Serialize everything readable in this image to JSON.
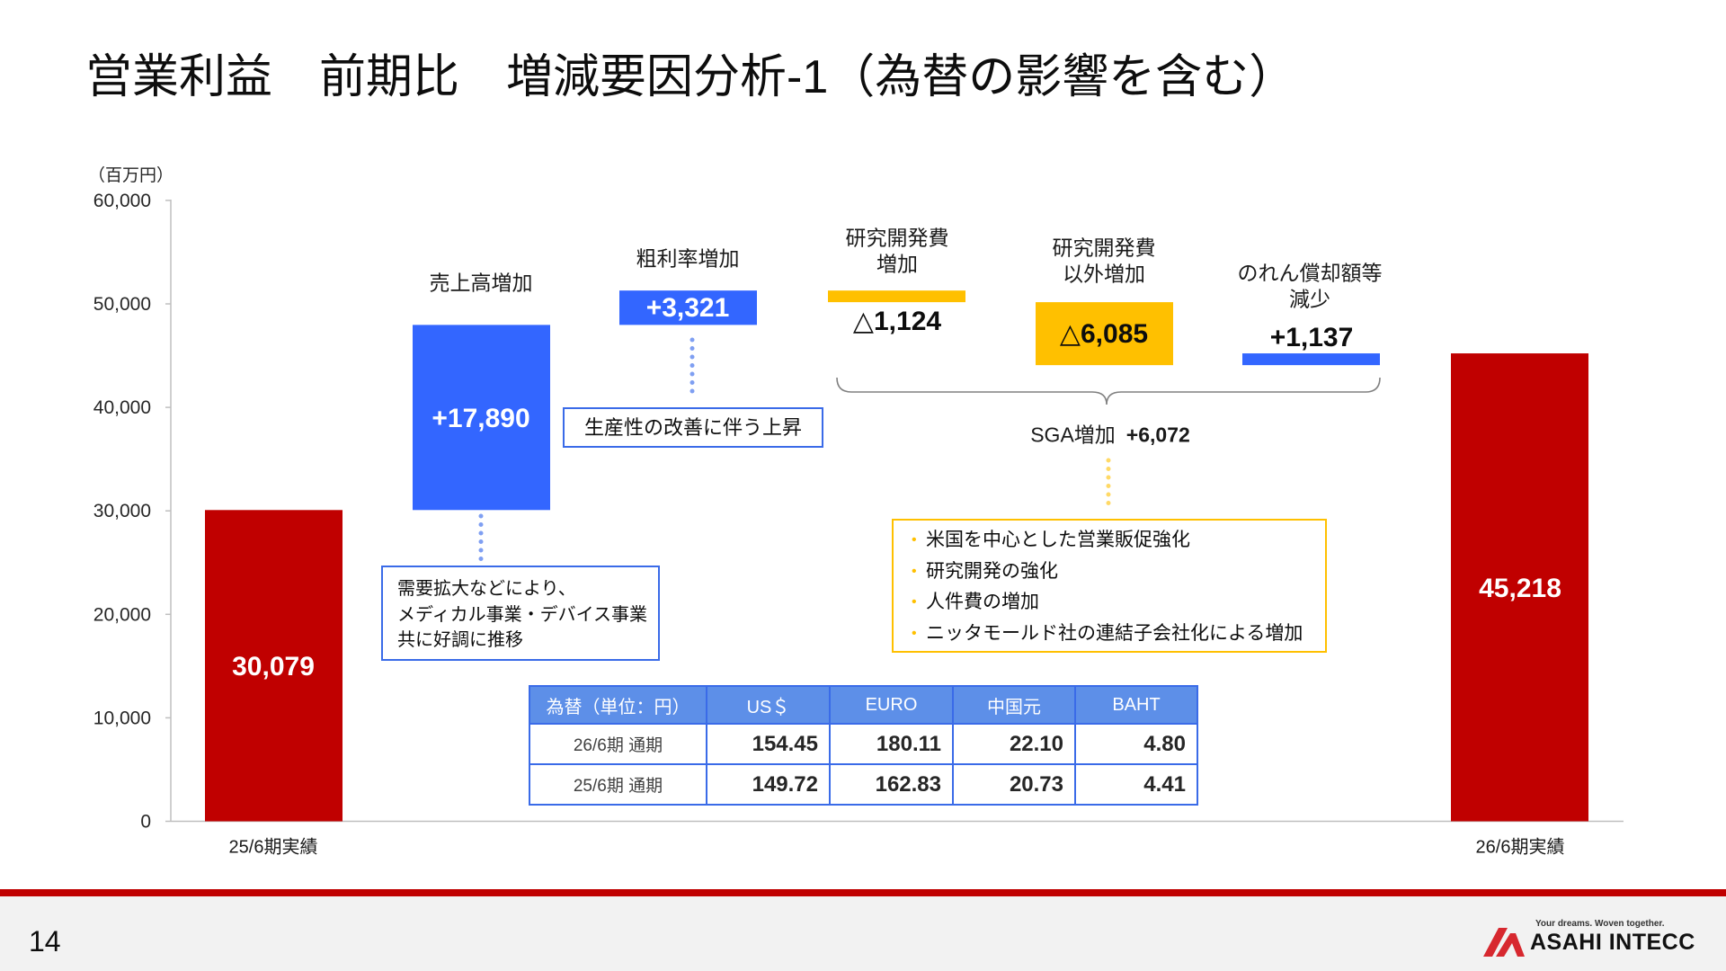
{
  "slide": {
    "title": "営業利益　前期比　増減要因分析-1（為替の影響を含む）",
    "page_number": "14"
  },
  "chart_data": {
    "type": "bar",
    "subtype": "waterfall",
    "unit_label": "（百万円）",
    "ylim": [
      0,
      60000
    ],
    "yticks": [
      "0",
      "10,000",
      "20,000",
      "30,000",
      "40,000",
      "50,000",
      "60,000"
    ],
    "grid": false,
    "bars": [
      {
        "kind": "total",
        "axis_label": "25/6期実績",
        "value": 30079,
        "value_label": "30,079",
        "color": "#C00000"
      },
      {
        "kind": "delta",
        "step_label": "売上高増加",
        "value": 17890,
        "value_label": "+17,890",
        "color": "#3366FF"
      },
      {
        "kind": "delta",
        "step_label": "粗利率増加",
        "value": 3321,
        "value_label": "+3,321",
        "color": "#3366FF"
      },
      {
        "kind": "delta",
        "step_label": "研究開発費\n増加",
        "value": -1124,
        "value_label": "△1,124",
        "color": "#FFC000"
      },
      {
        "kind": "delta",
        "step_label": "研究開発費\n以外増加",
        "value": -6085,
        "value_label": "△6,085",
        "color": "#FFC000"
      },
      {
        "kind": "delta",
        "step_label": "のれん償却額等\n減少",
        "value": 1137,
        "value_label": "+1,137",
        "color": "#3366FF"
      },
      {
        "kind": "total",
        "axis_label": "26/6期実績",
        "value": 45218,
        "value_label": "45,218",
        "color": "#C00000"
      }
    ],
    "brace": {
      "label": "SGA増加",
      "value_label": "+6,072",
      "value": 6072
    }
  },
  "notes": {
    "productivity": "生産性の改善に伴う上昇",
    "demand": "需要拡大などにより、\nメディカル事業・デバイス事業\n共に好調に推移",
    "sga_factors": [
      "米国を中心とした営業販促強化",
      "研究開発の強化",
      "人件費の増加",
      "ニッタモールド社の連結子会社化による増加"
    ],
    "bullet": "•"
  },
  "fx_table": {
    "headers": [
      "為替（単位：円）",
      "US＄",
      "EURO",
      "中国元",
      "BAHT"
    ],
    "rows": [
      [
        "26/6期 通期",
        "154.45",
        "180.11",
        "22.10",
        "4.80"
      ],
      [
        "25/6期 通期",
        "149.72",
        "162.83",
        "20.73",
        "4.41"
      ]
    ]
  },
  "logo": {
    "tagline": "Your dreams. Woven together.",
    "name": "ASAHI INTECC"
  },
  "colors": {
    "total_bar": "#C00000",
    "increase_bar": "#3366FF",
    "decrease_bar": "#FFC000",
    "footer_line": "#C00000"
  }
}
